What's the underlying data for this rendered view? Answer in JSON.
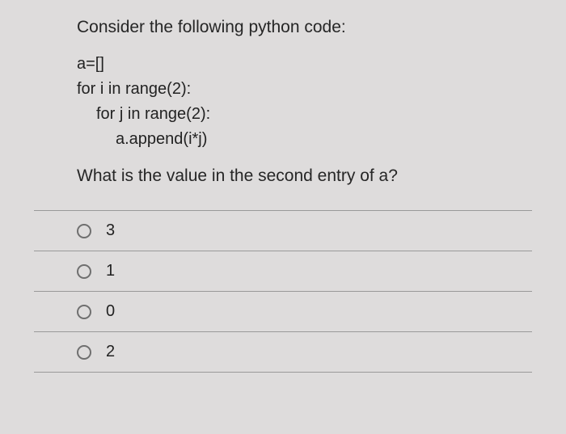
{
  "prompt": "Consider the following python code:",
  "code": {
    "l1": "a=[]",
    "l2": "for i in range(2):",
    "l3": "for j in range(2):",
    "l4": "a.append(i*j)"
  },
  "question": "What is the value in the second entry of a?",
  "options": [
    {
      "label": "3"
    },
    {
      "label": "1"
    },
    {
      "label": "0"
    },
    {
      "label": "2"
    }
  ]
}
